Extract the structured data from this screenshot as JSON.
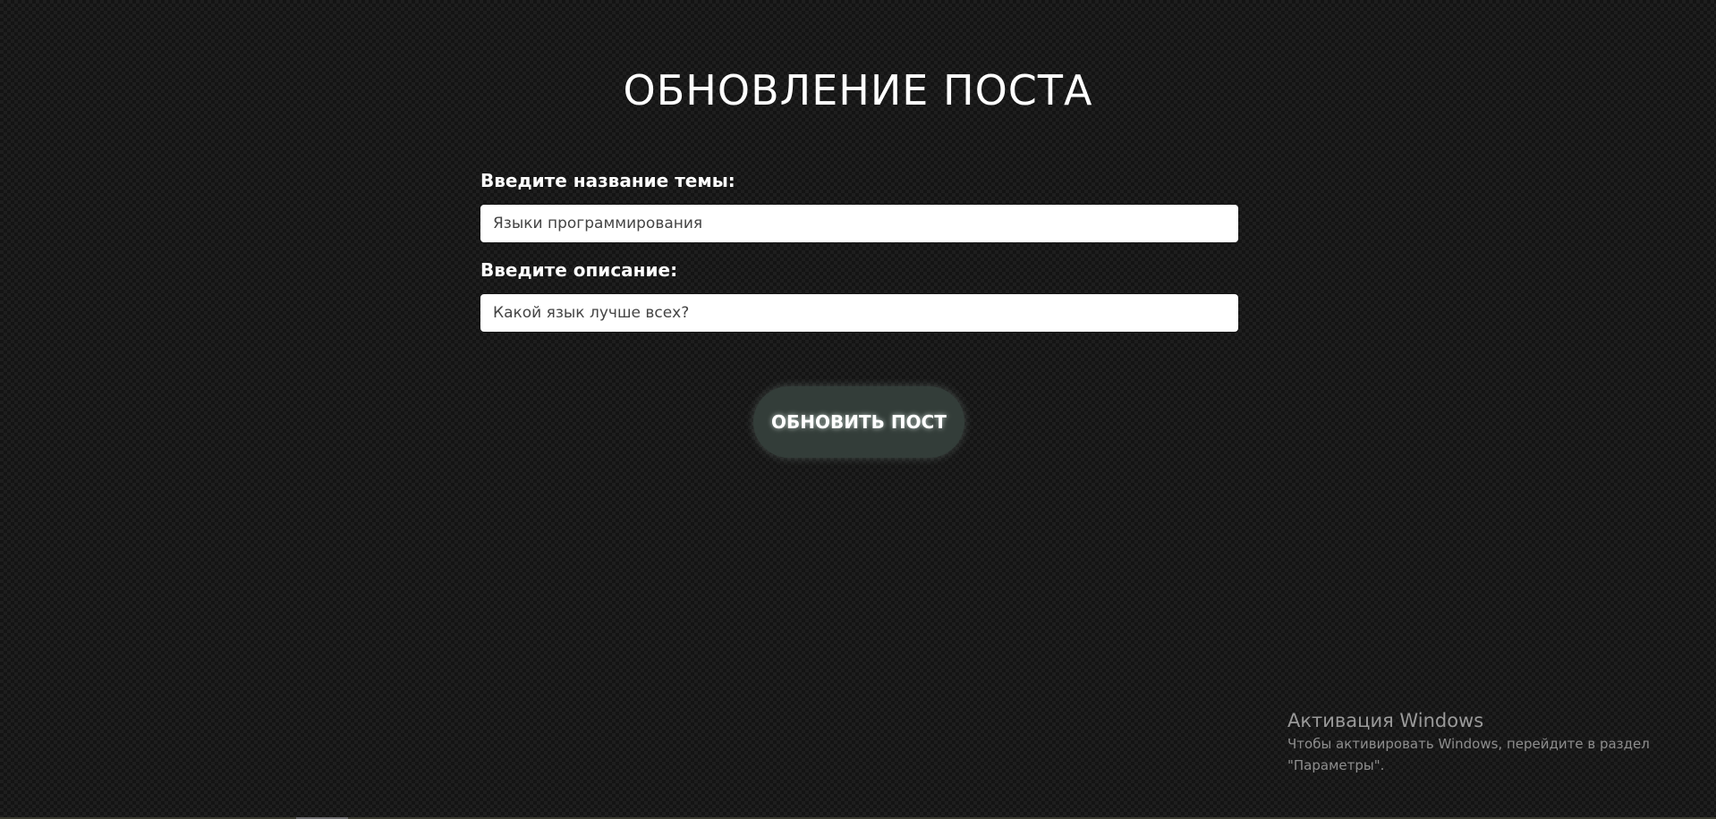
{
  "page": {
    "title": "ОБНОВЛЕНИЕ ПОСТА"
  },
  "form": {
    "topic_label": "Введите название темы:",
    "topic_value": "Языки программирования",
    "description_label": "Введите описание:",
    "description_value": "Какой язык лучше всех?",
    "submit_label": "ОБНОВИТЬ ПОСТ"
  },
  "windows_activation": {
    "title": "Активация Windows",
    "text_line1": "Чтобы активировать Windows, перейдите в раздел",
    "text_line2": "\"Параметры\"."
  },
  "colors": {
    "background": "#1e1e1e",
    "button": "#333d39",
    "text": "#ffffff"
  }
}
